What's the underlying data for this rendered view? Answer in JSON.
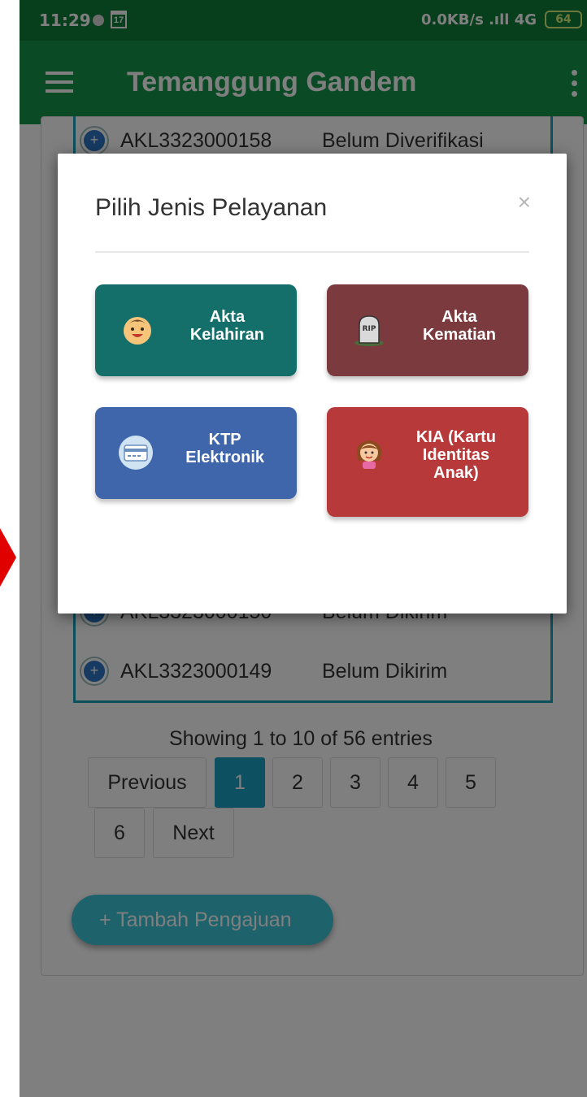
{
  "status_bar": {
    "time": "11:29",
    "calendar_day": "17",
    "network": "0.0KB/s .ıll 4G",
    "battery": "64"
  },
  "app_bar": {
    "title": "Temanggung Gandem"
  },
  "table": {
    "rows": [
      {
        "code": "AKL3323000158",
        "status": "Belum Diverifikasi"
      },
      {
        "code": "AKL3323000150",
        "status": "Belum Dikirim"
      },
      {
        "code": "AKL3323000149",
        "status": "Belum Dikirim"
      }
    ]
  },
  "pagination": {
    "info": "Showing 1 to 10 of 56 entries",
    "previous": "Previous",
    "pages": [
      "1",
      "2",
      "3",
      "4",
      "5",
      "6"
    ],
    "next": "Next",
    "active_page": "1"
  },
  "add_button": {
    "label": "+ Tambah Pengajuan"
  },
  "modal": {
    "title": "Pilih Jenis Pelayanan",
    "close": "×",
    "services": [
      {
        "label": "Akta\nKelahiran",
        "icon": "baby-icon",
        "color": "#146f6b"
      },
      {
        "label": "Akta\nKematian",
        "icon": "tombstone-icon",
        "color": "#7a3a3e"
      },
      {
        "label": "KTP\nElektronik",
        "icon": "id-card-icon",
        "color": "#3f66ab"
      },
      {
        "label": "KIA (Kartu\nIdentitas\nAnak)",
        "icon": "girl-icon",
        "color": "#b8393a"
      }
    ]
  }
}
